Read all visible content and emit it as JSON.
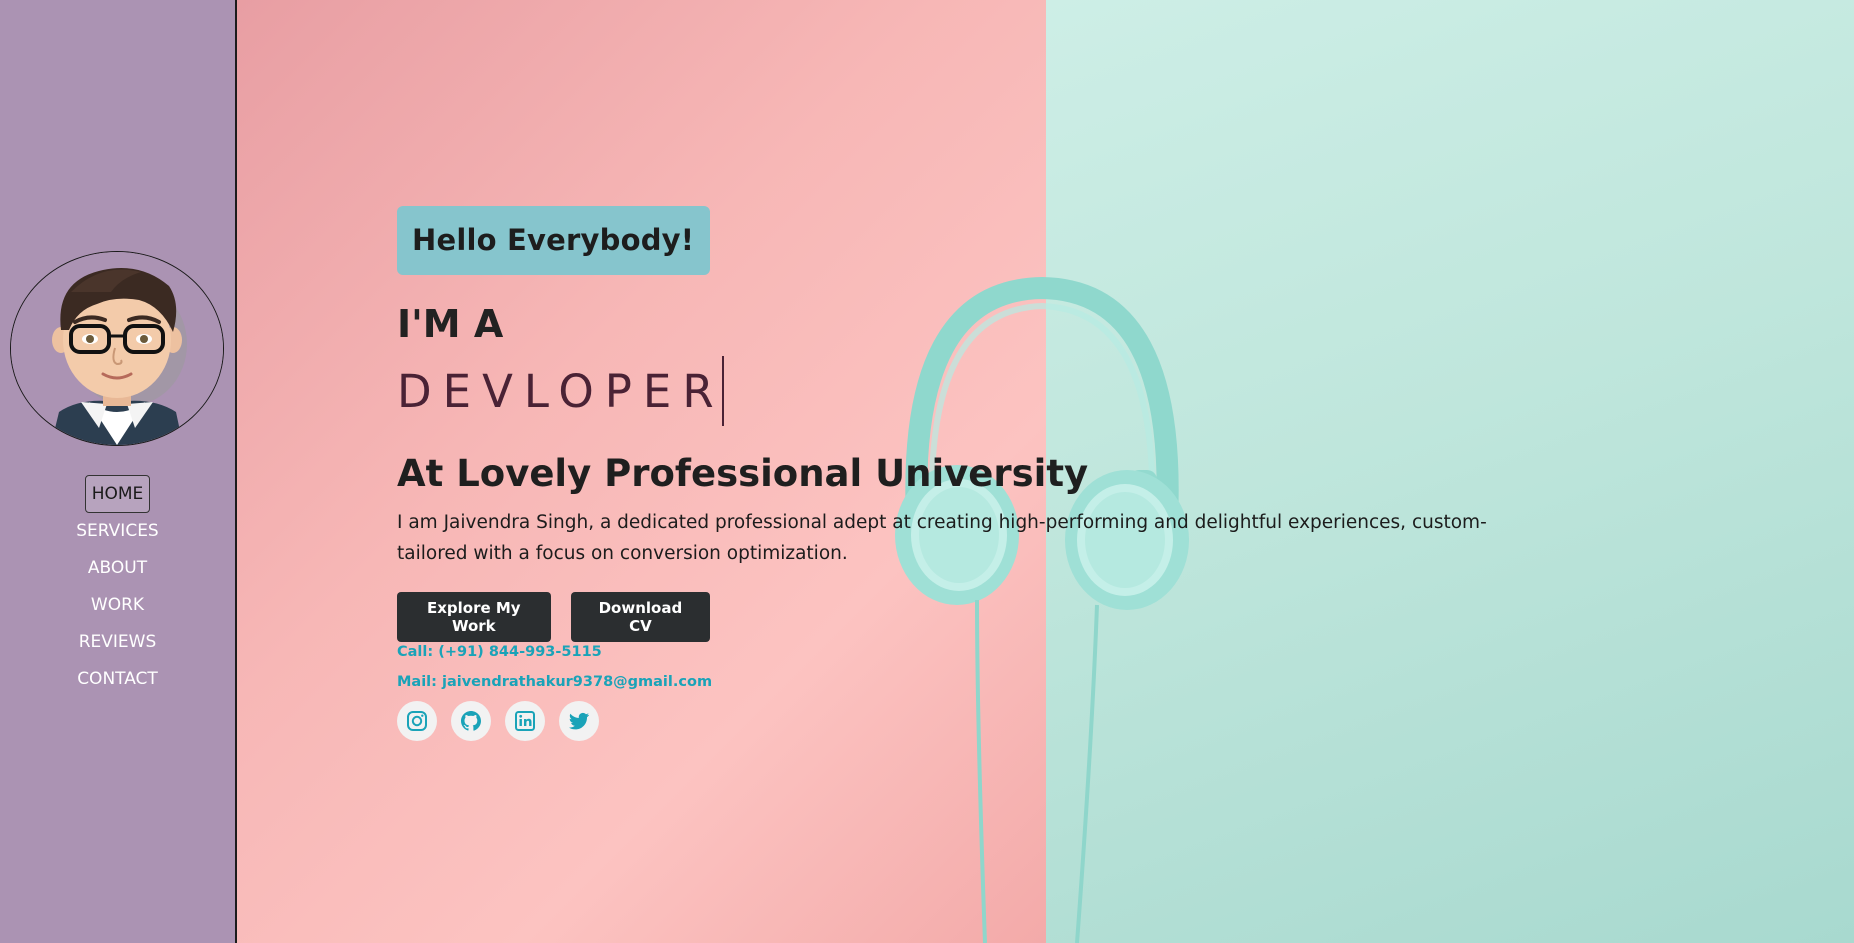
{
  "sidebar": {
    "avatar_alt": "avatar",
    "nav": [
      {
        "label": "HOME",
        "active": true
      },
      {
        "label": "SERVICES",
        "active": false
      },
      {
        "label": "ABOUT",
        "active": false
      },
      {
        "label": "WORK",
        "active": false
      },
      {
        "label": "REVIEWS",
        "active": false
      },
      {
        "label": "CONTACT",
        "active": false
      }
    ]
  },
  "hero": {
    "greeting": "Hello Everybody!",
    "intro": "I'M A",
    "role": "DEVLOPER",
    "university": "At Lovely Professional University",
    "description": "I am Jaivendra Singh, a dedicated professional adept at creating high-performing and delightful experiences, custom-tailored with a focus on conversion optimization.",
    "buttons": {
      "explore": "Explore My Work",
      "download": "Download CV"
    },
    "call": "Call: (+91) 844-993-5115",
    "mail": "Mail: jaivendrathakur9378@gmail.com",
    "socials": [
      "instagram-icon",
      "github-icon",
      "linkedin-icon",
      "twitter-icon"
    ]
  },
  "colors": {
    "sidebar_bg": "#ab93b3",
    "greeting_bg": "#86c5cd",
    "button_bg": "#2b2e30",
    "link_accent": "#1aa3b8",
    "bg_pink": "#f7b7b6",
    "bg_mint": "#bfe6dc"
  }
}
